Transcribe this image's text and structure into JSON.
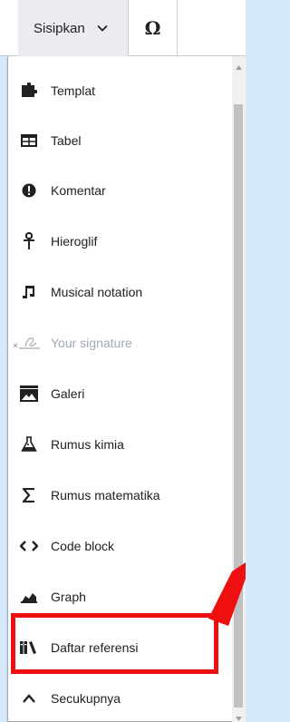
{
  "toolbar": {
    "insert_label": "Sisipkan",
    "special_chars_label": "Ω"
  },
  "menu": {
    "items": [
      {
        "label": "Templat",
        "icon": "puzzle-icon"
      },
      {
        "label": "Tabel",
        "icon": "table-icon"
      },
      {
        "label": "Komentar",
        "icon": "alert-icon"
      },
      {
        "label": "Hieroglif",
        "icon": "hieroglyph-icon"
      },
      {
        "label": "Musical notation",
        "icon": "music-note-icon"
      },
      {
        "label": "Your signature",
        "icon": "signature-icon",
        "disabled": true
      },
      {
        "label": "Galeri",
        "icon": "gallery-icon"
      },
      {
        "label": "Rumus kimia",
        "icon": "flask-icon"
      },
      {
        "label": "Rumus matematika",
        "icon": "sigma-icon"
      },
      {
        "label": "Code block",
        "icon": "code-icon"
      },
      {
        "label": "Graph",
        "icon": "graph-icon"
      },
      {
        "label": "Daftar referensi",
        "icon": "references-icon"
      },
      {
        "label": "Secukupnya",
        "icon": "chevron-up-icon"
      }
    ]
  },
  "colors": {
    "highlight": "#ee1010",
    "page_background": "#d7eafb"
  }
}
